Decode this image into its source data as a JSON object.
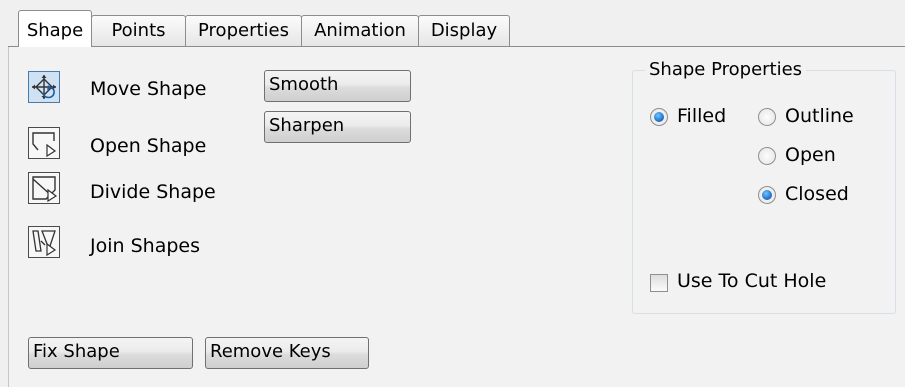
{
  "tabs": [
    {
      "label": "Shape",
      "active": true
    },
    {
      "label": "Points"
    },
    {
      "label": "Properties"
    },
    {
      "label": "Animation"
    },
    {
      "label": "Display"
    }
  ],
  "tools": [
    {
      "label": "Move Shape",
      "icon": "move-shape-icon",
      "active": true
    },
    {
      "label": "Open Shape",
      "icon": "open-shape-icon"
    },
    {
      "label": "Divide Shape",
      "icon": "divide-shape-icon"
    },
    {
      "label": "Join Shapes",
      "icon": "join-shapes-icon"
    }
  ],
  "buttons": {
    "smooth": "Smooth",
    "sharpen": "Sharpen",
    "fix_shape": "Fix Shape",
    "remove_keys": "Remove Keys"
  },
  "shape_properties": {
    "title": "Shape Properties",
    "fill_options": [
      {
        "label": "Filled",
        "selected": true
      },
      {
        "label": "Outline",
        "selected": false
      }
    ],
    "path_options": [
      {
        "label": "Open",
        "selected": false
      },
      {
        "label": "Closed",
        "selected": true
      }
    ],
    "cut_hole": {
      "label": "Use To Cut Hole",
      "checked": false
    }
  },
  "colors": {
    "selected_radio": "#1c66c1",
    "active_tool_bg": "#cfe2f3"
  }
}
